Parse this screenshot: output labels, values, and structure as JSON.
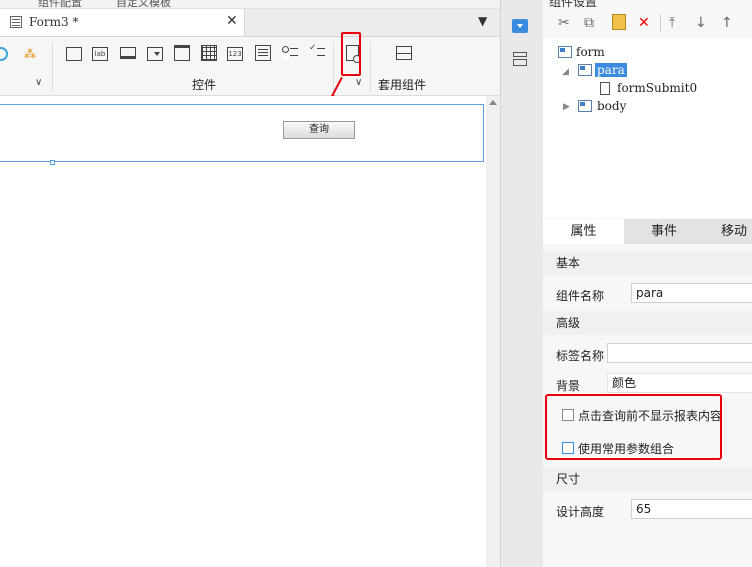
{
  "top_strip": {
    "item1": "组件配置",
    "item2": "自定义模板"
  },
  "tab": {
    "title": "Form3 *",
    "close_icon": "close-icon",
    "menu_icon": "tab-menu-icon"
  },
  "toolbar": {
    "group_controls_label": "控件",
    "group_combo_label": "套用组件",
    "icons": [
      "text-box-icon",
      "label-icon",
      "button-icon",
      "combo-box-icon",
      "dropdown-tree-icon",
      "date-icon",
      "number-icon",
      "text-area-icon",
      "radio-group-icon",
      "checkbox-group-icon",
      "query-button-icon",
      "combo-component-icon"
    ],
    "highlight_color": "#e8000b"
  },
  "canvas": {
    "query_button_label": "查询"
  },
  "mid_strip": {
    "icons": [
      "widget-dropdown-icon",
      "layout-icon"
    ]
  },
  "right_panel": {
    "header": "组件设置",
    "toolbar_icons": [
      "cut-icon",
      "copy-icon",
      "paste-icon",
      "delete-icon",
      "move-top-icon",
      "move-down-icon",
      "move-up-icon"
    ],
    "tree": {
      "form": "form",
      "para": "para",
      "formSubmit0": "formSubmit0",
      "body": "body"
    },
    "tabs": [
      "属性",
      "事件",
      "移动"
    ],
    "sections": {
      "basic": "基本",
      "advanced": "高级",
      "size": "尺寸"
    },
    "props": {
      "component_name_label": "组件名称",
      "component_name_value": "para",
      "tag_name_label": "标签名称",
      "tag_name_value": "",
      "background_label": "背景",
      "background_value": "颜色",
      "hide_before_query_label": "点击查询前不显示报表内容",
      "use_param_combo_label": "使用常用参数组合",
      "design_height_label": "设计高度",
      "design_height_value": "65"
    },
    "accent_color": "#3b8cde"
  }
}
